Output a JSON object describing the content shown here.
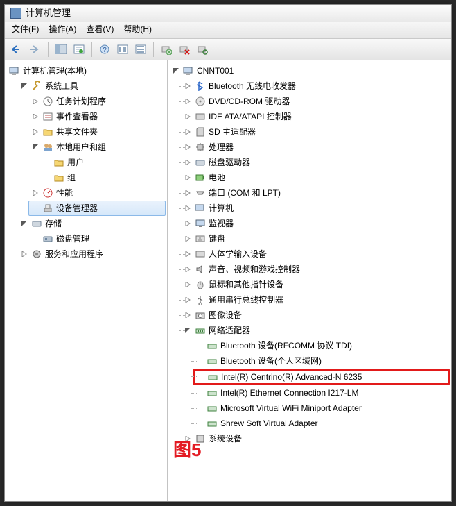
{
  "window": {
    "title": "计算机管理"
  },
  "menu": {
    "file": "文件(F)",
    "action": "操作(A)",
    "view": "查看(V)",
    "help": "帮助(H)"
  },
  "left_tree": {
    "root": "计算机管理(本地)",
    "tools": {
      "label": "系统工具",
      "children": {
        "scheduler": "任务计划程序",
        "eventvwr": "事件查看器",
        "shares": "共享文件夹",
        "localusers": {
          "label": "本地用户和组",
          "users": "用户",
          "groups": "组"
        },
        "perf": "性能",
        "devmgr": "设备管理器"
      }
    },
    "storage": {
      "label": "存储",
      "diskmgmt": "磁盘管理"
    },
    "services": "服务和应用程序"
  },
  "device_tree": {
    "root": "CNNT001",
    "cats": {
      "bt": "Bluetooth 无线电收发器",
      "dvd": "DVD/CD-ROM 驱动器",
      "ide": "IDE ATA/ATAPI 控制器",
      "sd": "SD 主适配器",
      "cpu": "处理器",
      "disk": "磁盘驱动器",
      "battery": "电池",
      "ports": "端口 (COM 和 LPT)",
      "computer": "计算机",
      "monitor": "监视器",
      "keyboard": "键盘",
      "hid": "人体学输入设备",
      "sound": "声音、视频和游戏控制器",
      "mouse": "鼠标和其他指针设备",
      "usb": "通用串行总线控制器",
      "imaging": "图像设备",
      "net": {
        "label": "网络适配器",
        "items": [
          "Bluetooth 设备(RFCOMM 协议 TDI)",
          "Bluetooth 设备(个人区域网)",
          "Intel(R) Centrino(R) Advanced-N 6235",
          "Intel(R) Ethernet Connection I217-LM",
          "Microsoft Virtual WiFi Miniport Adapter",
          "Shrew Soft Virtual Adapter"
        ]
      },
      "sys": "系统设备"
    }
  },
  "caption": "图5"
}
